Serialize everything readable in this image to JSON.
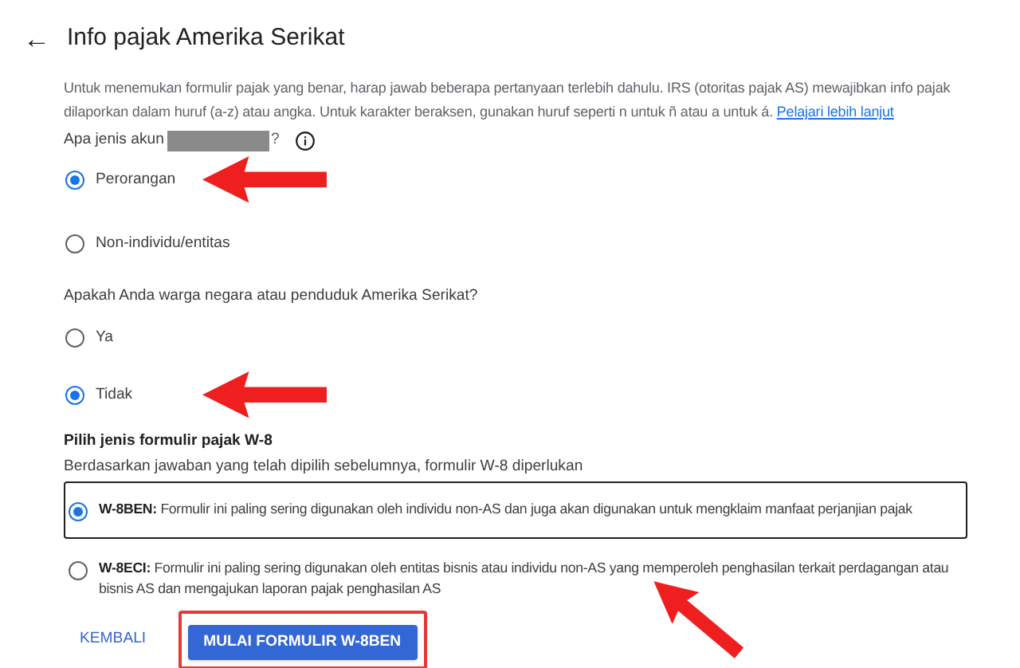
{
  "header": {
    "back": "←",
    "title": "Info pajak Amerika Serikat"
  },
  "intro": {
    "text": "Untuk menemukan formulir pajak yang benar, harap jawab beberapa pertanyaan terlebih dahulu. IRS (otoritas pajak AS) mewajibkan info pajak dilaporkan dalam huruf (a-z) atau angka. Untuk karakter beraksen, gunakan huruf seperti n untuk ñ atau a untuk á.",
    "link": "Pelajari lebih lanjut"
  },
  "questions": [
    {
      "label": "Apa jenis akun",
      "label_end": "?",
      "redacted": true,
      "info": true,
      "options": [
        {
          "label": "Perorangan",
          "selected": true
        },
        {
          "label": "Non-individu/entitas",
          "selected": false
        }
      ]
    },
    {
      "label": "Apakah Anda warga negara atau penduduk Amerika Serikat?",
      "options": [
        {
          "label": "Ya",
          "selected": false
        },
        {
          "label": "Tidak",
          "selected": true
        }
      ]
    }
  ],
  "form_type": {
    "title": "Pilih jenis formulir pajak W-8",
    "subtitle": "Berdasarkan jawaban yang telah dipilih sebelumnya, formulir W-8 diperlukan",
    "options": [
      {
        "code": "W-8BEN:",
        "description": "Formulir ini paling sering digunakan oleh individu non-AS dan juga akan digunakan untuk mengklaim manfaat perjanjian pajak",
        "selected": true
      },
      {
        "code": "W-8ECI:",
        "description": "Formulir ini paling sering digunakan oleh entitas bisnis atau individu non-AS yang memperoleh penghasilan terkait perdagangan atau bisnis AS dan mengajukan laporan pajak penghasilan AS",
        "selected": false
      }
    ]
  },
  "buttons": [
    {
      "label": "KEMBALI",
      "kind": "text"
    },
    {
      "label": "MULAI FORMULIR W-8BEN",
      "kind": "primary"
    }
  ]
}
